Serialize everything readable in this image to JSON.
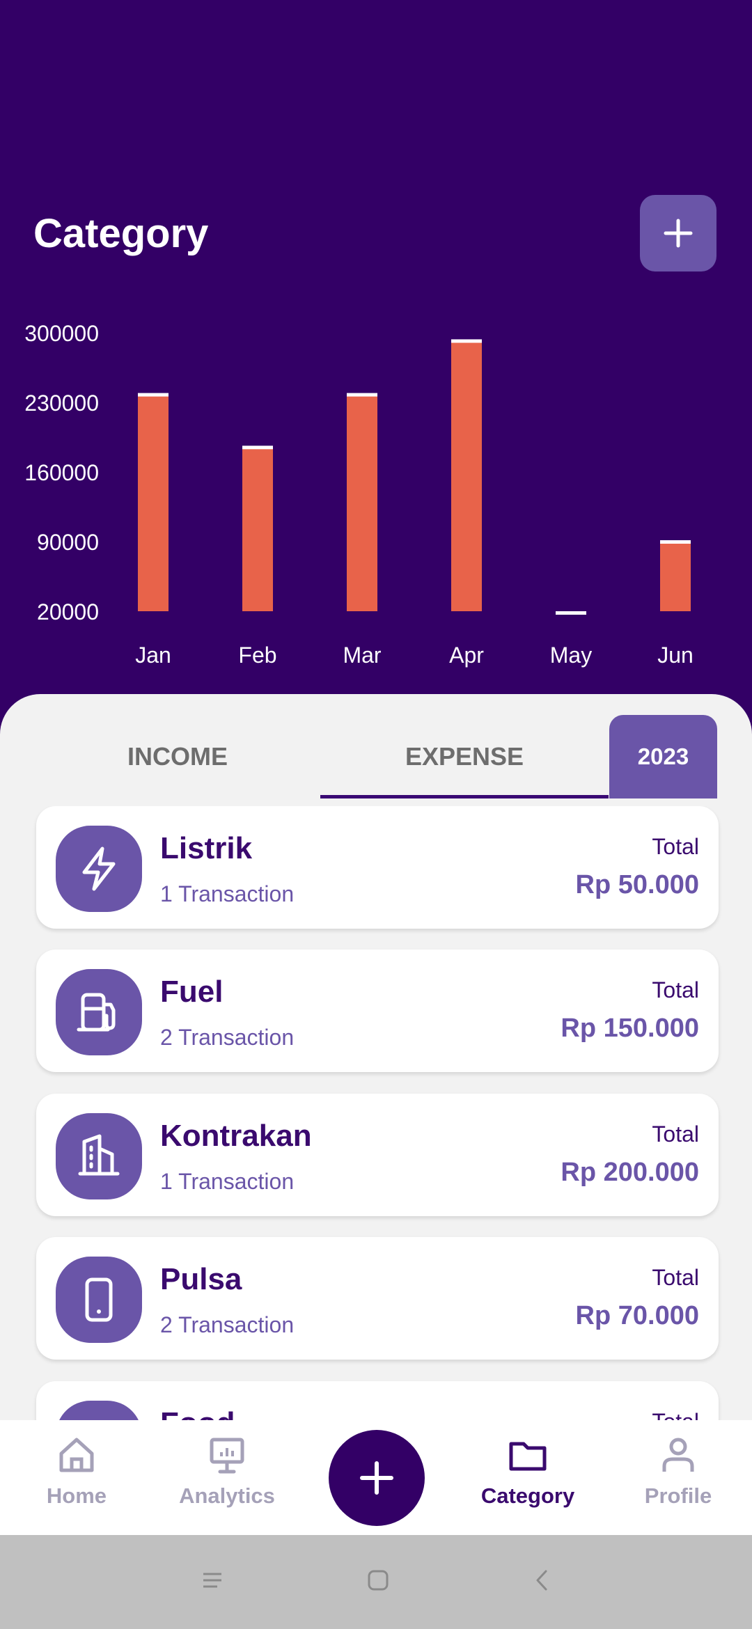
{
  "header": {
    "title": "Category",
    "add_icon": "plus-icon"
  },
  "chart_data": {
    "type": "bar",
    "categories": [
      "Jan",
      "Feb",
      "Mar",
      "Apr",
      "May",
      "Jun"
    ],
    "values": [
      238000,
      185000,
      238000,
      292000,
      1000,
      90000
    ],
    "yticks": [
      "300000",
      "230000",
      "160000",
      "90000",
      "20000"
    ],
    "ylim": [
      20000,
      300000
    ],
    "bar_color": "#e8634a",
    "cap_color": "#ffffff"
  },
  "tabs": {
    "income": "INCOME",
    "expense": "EXPENSE",
    "year": "2023"
  },
  "categories": [
    {
      "name": "Listrik",
      "count": "1 Transaction",
      "total_label": "Total",
      "total": "Rp 50.000",
      "icon": "lightning-icon"
    },
    {
      "name": "Fuel",
      "count": "2 Transaction",
      "total_label": "Total",
      "total": "Rp 150.000",
      "icon": "fuel-pump-icon"
    },
    {
      "name": "Kontrakan",
      "count": "1 Transaction",
      "total_label": "Total",
      "total": "Rp 200.000",
      "icon": "building-icon"
    },
    {
      "name": "Pulsa",
      "count": "2 Transaction",
      "total_label": "Total",
      "total": "Rp 70.000",
      "icon": "phone-icon"
    },
    {
      "name": "Food",
      "count": "",
      "total_label": "Total",
      "total": "",
      "icon": "food-icon"
    }
  ],
  "nav": {
    "home": "Home",
    "analytics": "Analytics",
    "category": "Category",
    "profile": "Profile"
  },
  "colors": {
    "primary_dark": "#330066",
    "accent": "#6a55a8",
    "bar": "#e8634a"
  }
}
